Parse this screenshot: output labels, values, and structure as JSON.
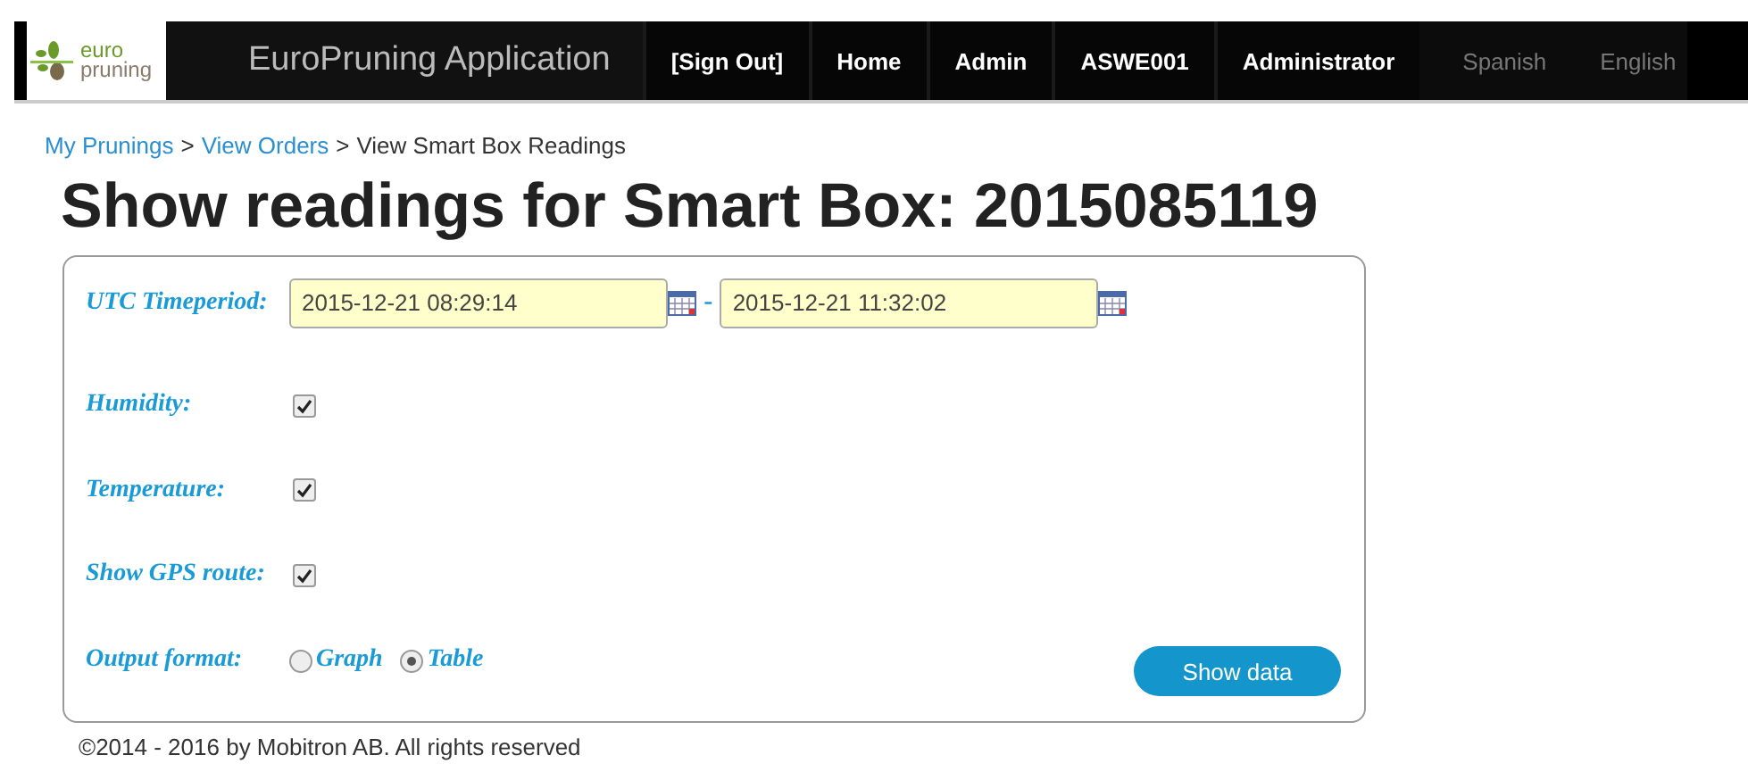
{
  "header": {
    "logo": {
      "line1": "euro",
      "line2": "pruning"
    },
    "title": "EuroPruning Application",
    "nav": [
      {
        "label": "[Sign Out]",
        "kind": "link"
      },
      {
        "label": "Home",
        "kind": "link"
      },
      {
        "label": "Admin",
        "kind": "link"
      },
      {
        "label": "ASWE001",
        "kind": "link"
      },
      {
        "label": "Administrator",
        "kind": "link"
      },
      {
        "label": "Spanish",
        "kind": "language"
      },
      {
        "label": "English",
        "kind": "language"
      }
    ]
  },
  "breadcrumb": [
    {
      "label": "My Prunings",
      "link": true,
      "separator": ">"
    },
    {
      "label": "View Orders",
      "link": true,
      "separator": ">"
    },
    {
      "label": "View Smart Box Readings",
      "link": false
    }
  ],
  "heading": "Show readings for Smart Box: 2015085119",
  "form": {
    "rows": [
      {
        "kind": "datetime",
        "label": "UTC Timeperiod:",
        "from": "2015-12-21 08:29:14",
        "separator": "-",
        "to": "2015-12-21 11:32:02"
      },
      {
        "kind": "checkbox",
        "label": "Humidity:",
        "checked": true
      },
      {
        "kind": "checkbox",
        "label": "Temperature:",
        "checked": true
      },
      {
        "kind": "checkbox",
        "label": "Show GPS route:",
        "checked": true
      },
      {
        "kind": "radio",
        "label": "Output format:",
        "options": [
          {
            "label": "Graph",
            "selected": false
          },
          {
            "label": "Table",
            "selected": true
          }
        ]
      }
    ],
    "button": "Show data"
  },
  "footer": "©2014 - 2016 by Mobitron AB. All rights reserved"
}
